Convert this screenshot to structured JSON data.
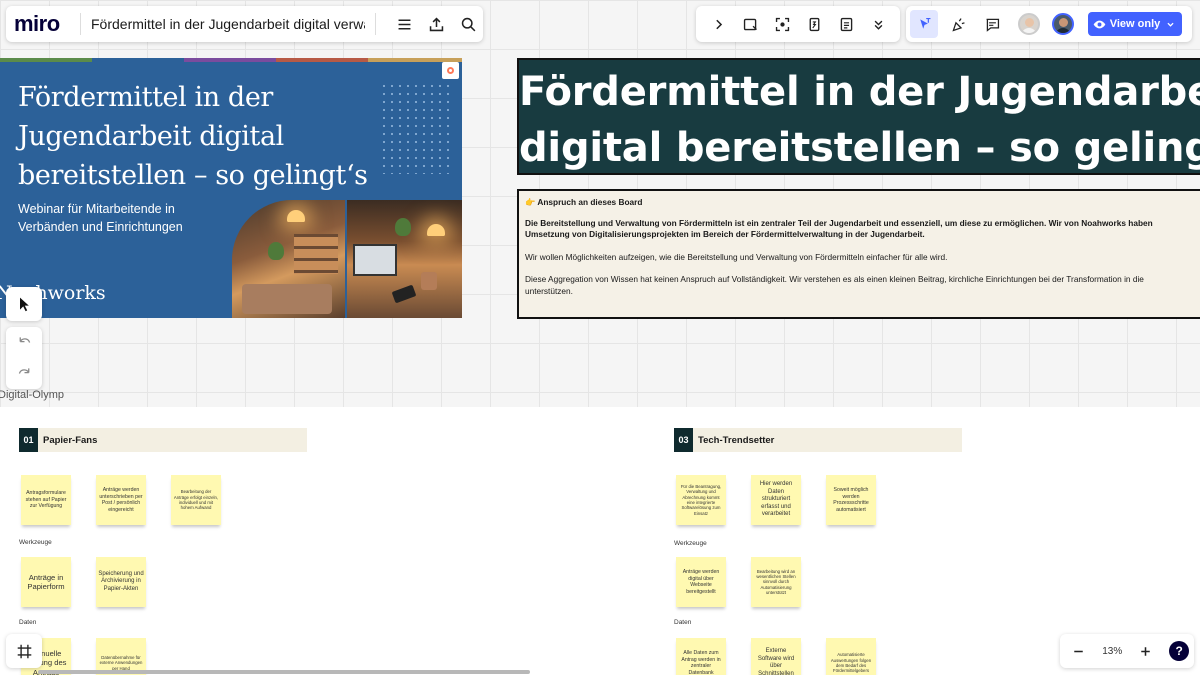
{
  "app": {
    "logo": "miro",
    "board_title": "Fördermittel in der Jugendarbeit digital verwalten",
    "view_only_label": "View only",
    "zoom_level": "13%",
    "help_label": "?",
    "accent_color": "#4262ff"
  },
  "title_card": {
    "title": "Fördermittel in der Jugendarbeit digital bereitstellen – so gelingt‘s",
    "subtitle": "Webinar für Mitarbeitende in Verbänden und Einrichtungen",
    "brand": "Noahworks",
    "background_color": "#2c6199"
  },
  "heading": {
    "text_line1": "Fördermittel in der Jugendarbeit",
    "text_line2": "digital bereitstellen – so gelingt's"
  },
  "claim": {
    "heading": "👉 Anspruch an dieses Board",
    "bold_line1": "Die Bereitstellung und Verwaltung von Fördermitteln ist ein zentraler Teil der Jugendarbeit und essenziell, um diese zu ermöglichen. Wir von Noahworks haben",
    "bold_line2": "Umsetzung von Digitalisierungsprojekten im Bereich der Fördermittelverwaltung in der Jugendarbeit.",
    "para2": "Wir wollen Möglichkeiten aufzeigen, wie die Bereitstellung und Verwaltung von Fördermitteln einfacher für alle wird.",
    "para3_line1": "Diese Aggregation von Wissen hat keinen Anspruch auf Vollständigkeit. Wir verstehen es als einen kleinen Beitrag, kirchliche Einrichtungen bei der Transformation in die",
    "para3_line2": "unterstützen."
  },
  "frame_label": "Digital-Olymp",
  "sections": [
    {
      "number": "01",
      "title": "Papier-Fans",
      "row_labels": [
        "Werkzeuge",
        "Daten"
      ],
      "stickies": [
        "Antragsformulare stehen auf Papier zur Verfügung",
        "Anträge werden unterschrieben per Post / persönlich eingereicht",
        "Bearbeitung der Anträge erfolgt einzeln, individuell und mit hohem Aufwand",
        "Anträge in Papierform",
        "Speicherung und Archivierung in Papier-Akten",
        "Manuelle Prüfung des Antrags",
        "Datenübernahme für externe Anwendungen per Hand"
      ]
    },
    {
      "number": "03",
      "title": "Tech-Trendsetter",
      "row_labels": [
        "Werkzeuge",
        "Daten"
      ],
      "stickies": [
        "Für die Beantragung, Verwaltung und Abrechnung kommt eine integrierte Softwarelösung zum Einsatz",
        "Hier werden Daten strukturiert erfasst und verarbeitet",
        "Soweit möglich werden Prozessschritte automatisiert",
        "Anträge werden digital über Webseite bereitgestellt",
        "Bearbeitung wird an wesentlichen Stellen sinnvoll durch Automatisierung unterstützt",
        "Alle Daten zum Antrag werden in zentraler Datenbank",
        "Externe Software wird über Schnittstellen",
        "Automatisierte Auswertungen folgen dem Bedarf des Fördermittelgebers"
      ]
    }
  ]
}
